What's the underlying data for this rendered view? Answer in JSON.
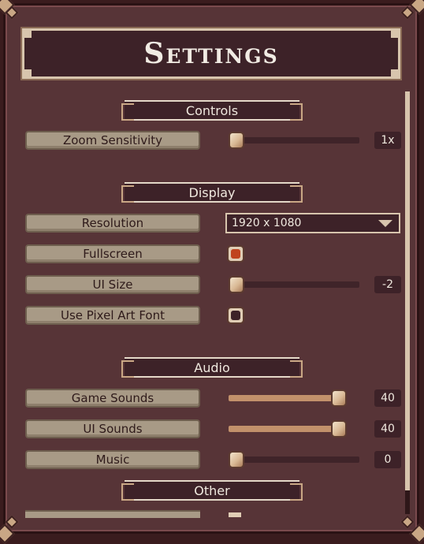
{
  "title": "Settings",
  "sections": {
    "controls": "Controls",
    "display": "Display",
    "audio": "Audio",
    "other": "Other"
  },
  "controls": {
    "zoom_sensitivity": {
      "label": "Zoom Sensitivity",
      "value": "1x",
      "fraction": 0.0
    }
  },
  "display": {
    "resolution": {
      "label": "Resolution",
      "selected": "1920 x 1080"
    },
    "fullscreen": {
      "label": "Fullscreen",
      "checked": true
    },
    "ui_size": {
      "label": "UI Size",
      "value": "-2",
      "fraction": 0.0
    },
    "pixel_font": {
      "label": "Use Pixel Art Font",
      "checked": false
    }
  },
  "audio": {
    "game_sounds": {
      "label": "Game Sounds",
      "value": "40",
      "fraction": 1.0
    },
    "ui_sounds": {
      "label": "UI Sounds",
      "value": "40",
      "fraction": 1.0
    },
    "music": {
      "label": "Music",
      "value": "0",
      "fraction": 0.0
    }
  },
  "colors": {
    "panel": "#573437",
    "dark": "#3d2228",
    "label_bg": "#a89a86",
    "accent": "#c0441e",
    "knob": "#d9b995"
  }
}
